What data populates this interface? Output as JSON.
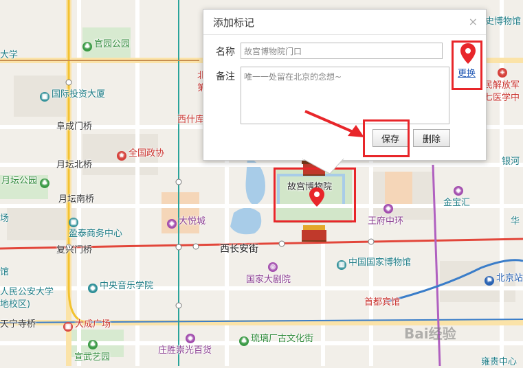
{
  "dialog": {
    "title": "添加标记",
    "close": "×",
    "name_label": "名称",
    "name_value": "故宫博物院门口",
    "note_label": "备注",
    "note_value": "唯一一处留在北京的念想~",
    "save_label": "保存",
    "delete_label": "删除",
    "change_label": "更换"
  },
  "map": {
    "roads": {
      "xichangan": "西长安街"
    },
    "pois": {
      "guanyuan": "官园公园",
      "guoji": "国际投资大厦",
      "fuchengmen": "阜成门桥",
      "quanguozhengxie": "全国政协",
      "xishiku": "西什库",
      "yuetanbei": "月坛北桥",
      "yuetanpark": "月坛公园",
      "yuetannan": "月坛南桥",
      "dayuecheng": "大悦城",
      "yingtai": "盈泰商务中心",
      "fuxingmen": "复兴门桥",
      "guanmg": "馆",
      "zhongyang": "中央音乐学院",
      "guojiadajuyuan": "国家大剧院",
      "zhongguoguojia": "中国国家博物馆",
      "gugong": "故宫博物院",
      "wangfujing": "王府中环",
      "jinbao": "金宝汇",
      "shoudu": "首都宾馆",
      "yinhe": "银河",
      "bjstation": "北京站",
      "gongan": "人民公安大学",
      "xiaoqu": "地校区)",
      "tianning": "天宁寺桥",
      "daguan": "大成广场",
      "xuanwu": "宣武艺园",
      "liulichang": "琉璃厂古文化街",
      "zhuangsheng": "庄胜崇光百货",
      "chongwen": "雍贵中心",
      "daxue": "大学",
      "hua": "华",
      "jiefangjun": "民解放军",
      "yixue": "七医学中",
      "bowuguan": "史博物馆",
      "bei": "北",
      "di": "第",
      "chang": "场"
    },
    "watermark": "Bai经验"
  },
  "colors": {
    "highlight": "#e8262a",
    "subway_red": "#e2463a",
    "subway_blue": "#3a7dc9",
    "subway_teal": "#2aa39a",
    "subway_purple": "#b060c0",
    "subway_yellow": "#f2c230",
    "link": "#1d55b3"
  }
}
